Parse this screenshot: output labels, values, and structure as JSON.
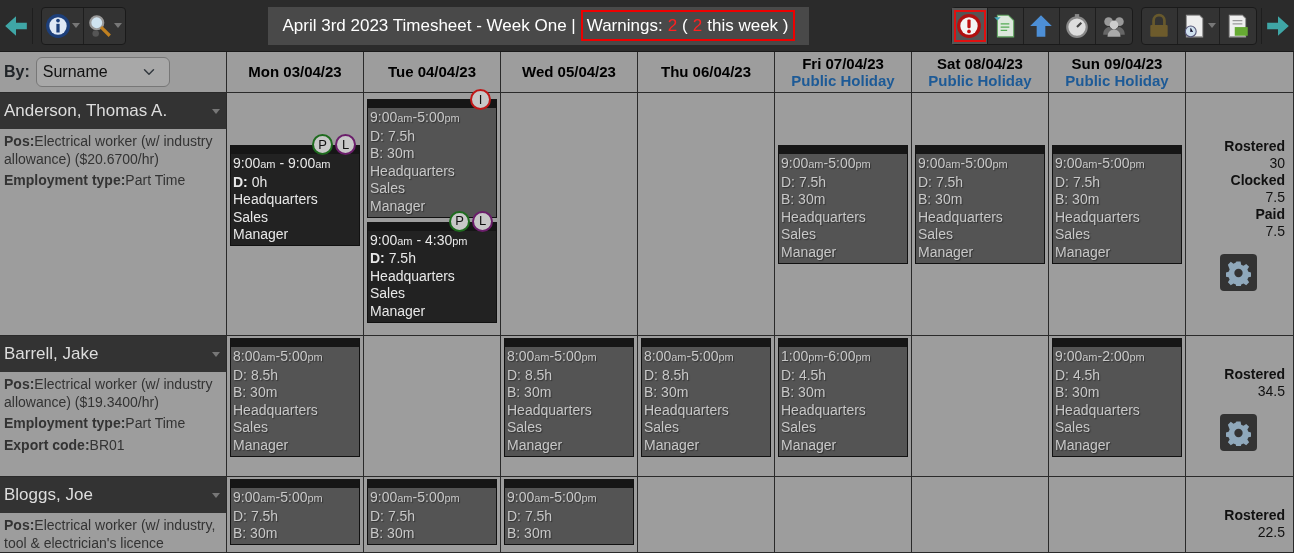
{
  "toolbar": {
    "left_tools": [
      {
        "kind": "info",
        "menu": true
      },
      {
        "kind": "lookup",
        "menu": true
      }
    ],
    "title": "April 3rd 2023 Timesheet - Week One |",
    "warnings": {
      "label": "Warnings:",
      "total": "2",
      "open": "(",
      "week": "2",
      "week_label": "this week )"
    },
    "right_groups": [
      {
        "tools": [
          {
            "kind": "warning",
            "active": true,
            "disabled": false,
            "menu": false
          },
          {
            "kind": "export",
            "active": false,
            "disabled": false,
            "menu": false
          },
          {
            "kind": "upload",
            "active": false,
            "disabled": false,
            "menu": false
          },
          {
            "kind": "stopwatch",
            "active": false,
            "disabled": false,
            "menu": false
          },
          {
            "kind": "people",
            "active": false,
            "disabled": false,
            "menu": false
          }
        ]
      },
      {
        "tools": [
          {
            "kind": "lock",
            "active": false,
            "disabled": true,
            "menu": false
          },
          {
            "kind": "timesheet",
            "active": false,
            "disabled": false,
            "menu": true
          },
          {
            "kind": "payslip",
            "active": false,
            "disabled": false,
            "menu": false
          }
        ]
      }
    ]
  },
  "sort": {
    "label": "By:",
    "value": "Surname"
  },
  "days": [
    {
      "label": "Mon 03/04/23"
    },
    {
      "label": "Tue 04/04/23"
    },
    {
      "label": "Wed 05/04/23"
    },
    {
      "label": "Thu 06/04/23"
    },
    {
      "label": "Fri 07/04/23",
      "note": "Public Holiday"
    },
    {
      "label": "Sat 08/04/23",
      "note": "Public Holiday"
    },
    {
      "label": "Sun 09/04/23",
      "note": "Public Holiday"
    }
  ],
  "employees": [
    {
      "name": "Anderson, Thomas A.",
      "details": [
        {
          "label": "Pos:",
          "value": "Electrical worker (w/ industry allowance) ($20.6700/hr)"
        },
        {
          "label": "Employment type:",
          "value": "Part Time"
        }
      ],
      "shifts": {
        "mon": [
          {
            "kind": "clocked",
            "start": "9:00",
            "start_period": "am",
            "separator": " - ",
            "end": "9:00",
            "end_period": "am",
            "lines": [
              "**D:** 0h",
              "Headquarters",
              "Sales",
              "Manager"
            ],
            "badges": [
              {
                "text": "P",
                "color": "#1e6b1e"
              },
              {
                "text": "L",
                "color": "#6b1e6b"
              }
            ]
          }
        ],
        "tue": [
          {
            "kind": "rostered",
            "start": "9:00",
            "start_period": "am",
            "separator": "-",
            "end": "5:00",
            "end_period": "pm",
            "lines": [
              "D: 7.5h",
              "B: 30m",
              "Headquarters",
              "Sales",
              "Manager"
            ],
            "badges": [
              {
                "text": "I",
                "color": "#c01818"
              }
            ]
          },
          {
            "kind": "clocked",
            "start": "9:00",
            "start_period": "am",
            "separator": " - ",
            "end": "4:30",
            "end_period": "pm",
            "lines": [
              "**D:** 7.5h",
              "Headquarters",
              "Sales",
              "Manager"
            ],
            "badges": [
              {
                "text": "P",
                "color": "#1e6b1e"
              },
              {
                "text": "L",
                "color": "#6b1e6b"
              }
            ]
          }
        ],
        "fri": [
          {
            "kind": "rostered",
            "start": "9:00",
            "start_period": "am",
            "separator": "-",
            "end": "5:00",
            "end_period": "pm",
            "lines": [
              "D: 7.5h",
              "B: 30m",
              "Headquarters",
              "Sales",
              "Manager"
            ]
          }
        ],
        "sat": [
          {
            "kind": "rostered",
            "start": "9:00",
            "start_period": "am",
            "separator": "-",
            "end": "5:00",
            "end_period": "pm",
            "lines": [
              "D: 7.5h",
              "B: 30m",
              "Headquarters",
              "Sales",
              "Manager"
            ]
          }
        ],
        "sun": [
          {
            "kind": "rostered",
            "start": "9:00",
            "start_period": "am",
            "separator": "-",
            "end": "5:00",
            "end_period": "pm",
            "lines": [
              "D: 7.5h",
              "B: 30m",
              "Headquarters",
              "Sales",
              "Manager"
            ]
          }
        ]
      },
      "totals": [
        {
          "label": "Rostered",
          "value": "30"
        },
        {
          "label": "Clocked",
          "value": "7.5"
        },
        {
          "label": "Paid",
          "value": "7.5"
        }
      ],
      "settings": true
    },
    {
      "name": "Barrell, Jake",
      "details": [
        {
          "label": "Pos:",
          "value": "Electrical worker (w/ industry allowance) ($19.3400/hr)"
        },
        {
          "label": "Employment type:",
          "value": "Part Time"
        },
        {
          "label": "Export code:",
          "value": "BR01"
        }
      ],
      "shifts": {
        "mon": [
          {
            "kind": "rostered",
            "start": "8:00",
            "start_period": "am",
            "separator": "-",
            "end": "5:00",
            "end_period": "pm",
            "lines": [
              "D: 8.5h",
              "B: 30m",
              "Headquarters",
              "Sales",
              "Manager"
            ]
          }
        ],
        "wed": [
          {
            "kind": "rostered",
            "start": "8:00",
            "start_period": "am",
            "separator": "-",
            "end": "5:00",
            "end_period": "pm",
            "lines": [
              "D: 8.5h",
              "B: 30m",
              "Headquarters",
              "Sales",
              "Manager"
            ]
          }
        ],
        "thu": [
          {
            "kind": "rostered",
            "start": "8:00",
            "start_period": "am",
            "separator": "-",
            "end": "5:00",
            "end_period": "pm",
            "lines": [
              "D: 8.5h",
              "B: 30m",
              "Headquarters",
              "Sales",
              "Manager"
            ]
          }
        ],
        "fri": [
          {
            "kind": "rostered",
            "start": "1:00",
            "start_period": "pm",
            "separator": "-",
            "end": "6:00",
            "end_period": "pm",
            "lines": [
              "D: 4.5h",
              "B: 30m",
              "Headquarters",
              "Sales",
              "Manager"
            ]
          }
        ],
        "sun": [
          {
            "kind": "rostered",
            "start": "9:00",
            "start_period": "am",
            "separator": "-",
            "end": "2:00",
            "end_period": "pm",
            "lines": [
              "D: 4.5h",
              "B: 30m",
              "Headquarters",
              "Sales",
              "Manager"
            ]
          }
        ]
      },
      "totals": [
        {
          "label": "Rostered",
          "value": "34.5"
        }
      ],
      "settings": true
    },
    {
      "name": "Bloggs, Joe",
      "details": [
        {
          "label": "Pos:",
          "value": "Electrical worker (w/ industry, tool & electrician's licence"
        }
      ],
      "shifts": {
        "mon": [
          {
            "kind": "rostered",
            "start": "9:00",
            "start_period": "am",
            "separator": "-",
            "end": "5:00",
            "end_period": "pm",
            "lines": [
              "D: 7.5h",
              "B: 30m"
            ]
          }
        ],
        "tue": [
          {
            "kind": "rostered",
            "start": "9:00",
            "start_period": "am",
            "separator": "-",
            "end": "5:00",
            "end_period": "pm",
            "lines": [
              "D: 7.5h",
              "B: 30m"
            ]
          }
        ],
        "wed": [
          {
            "kind": "rostered",
            "start": "9:00",
            "start_period": "am",
            "separator": "-",
            "end": "5:00",
            "end_period": "pm",
            "lines": [
              "D: 7.5h",
              "B: 30m"
            ]
          }
        ]
      },
      "totals": [
        {
          "label": "Rostered",
          "value": "22.5"
        }
      ]
    }
  ]
}
